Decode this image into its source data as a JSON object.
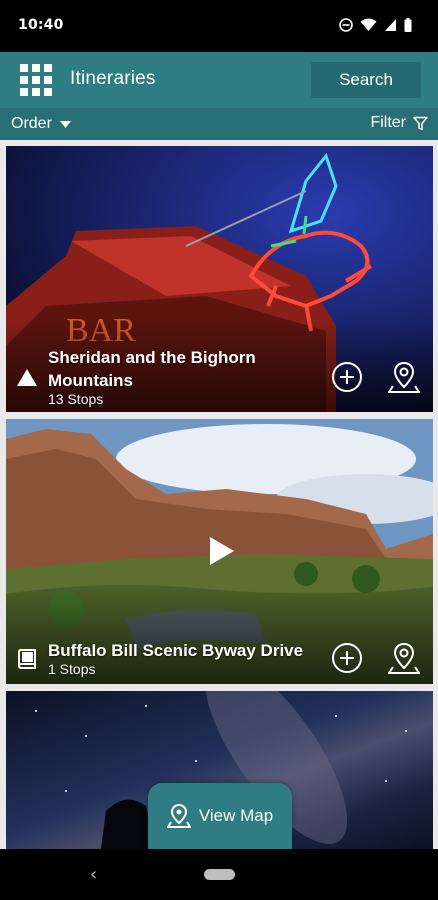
{
  "status": {
    "time": "10:40"
  },
  "appbar": {
    "title": "Itineraries",
    "search_label": "Search"
  },
  "toolbar": {
    "order_label": "Order",
    "filter_label": "Filter"
  },
  "cards": [
    {
      "title": "Sheridan and the Bighorn Mountains",
      "stops": "13 Stops",
      "category_icon": "mountain-icon"
    },
    {
      "title": "Buffalo Bill Scenic Byway Drive",
      "stops": "1 Stops",
      "category_icon": "book-icon",
      "media": "video"
    },
    {
      "title": "",
      "stops": "",
      "category_icon": ""
    }
  ],
  "view_map": {
    "label": "View Map"
  },
  "colors": {
    "primary": "#2e7d83",
    "primary_dark": "#256a70",
    "status_bar": "#000000"
  }
}
